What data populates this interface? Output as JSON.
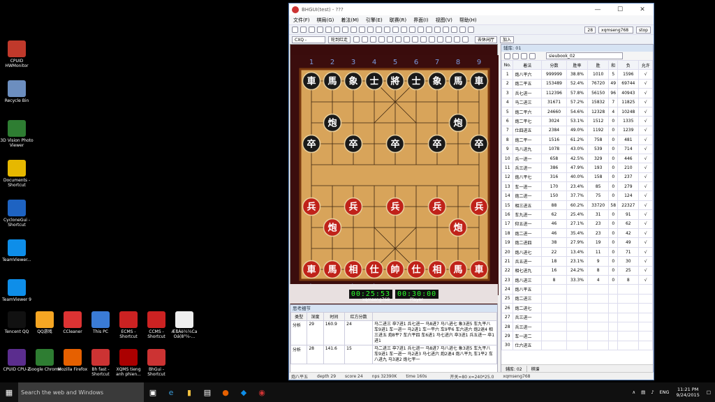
{
  "desktop_icons": [
    {
      "label": "CPUID HWMonitor",
      "icon": "hwmonitor-icon",
      "color": "#c0392b"
    },
    {
      "label": "Recycle Bin",
      "icon": "recycle-bin-icon",
      "color": "#6c8ebf"
    },
    {
      "label": "3D Vision Photo Viewer",
      "icon": "photo-viewer-icon",
      "color": "#2e7d32"
    },
    {
      "label": "Documents - Shortcut",
      "icon": "documents-icon",
      "color": "#e6b800"
    },
    {
      "label": "CycloneGui - Shortcut",
      "icon": "cyclone-icon",
      "color": "#1e63c2"
    },
    {
      "label": "TeamViewer...",
      "icon": "teamviewer-icon",
      "color": "#0e8ee9"
    },
    {
      "label": "TeamViewer 9",
      "icon": "teamviewer9-icon",
      "color": "#0e8ee9"
    }
  ],
  "desktop_row": [
    {
      "label": "Tencent QQ",
      "icon": "qq-icon",
      "color": "#111"
    },
    {
      "label": "QQ游戏",
      "icon": "qq-game-icon",
      "color": "#f5a623"
    },
    {
      "label": "CCleaner",
      "icon": "ccleaner-icon",
      "color": "#d33"
    },
    {
      "label": "This PC",
      "icon": "this-pc-icon",
      "color": "#3a7bd5"
    },
    {
      "label": "ECMS - Shortcut",
      "icon": "ecms-icon",
      "color": "#c22"
    },
    {
      "label": "CCMS - Shortcut",
      "icon": "ccms-icon",
      "color": "#c22"
    },
    {
      "label": "ÆßÁè¼¼Ca Oá(8³¼-...",
      "icon": "file-icon",
      "color": "#eee"
    }
  ],
  "desktop_row2": [
    {
      "label": "CPUID CPU-Z",
      "icon": "cpuz-icon",
      "color": "#5b2d8e"
    },
    {
      "label": "Google Chrome",
      "icon": "chrome-icon",
      "color": "#2e7d32"
    },
    {
      "label": "Mozilla Firefox",
      "icon": "firefox-icon",
      "color": "#e66000"
    },
    {
      "label": "Bh fast - Shortcut",
      "icon": "bh-fast-icon",
      "color": "#c33"
    },
    {
      "label": "XQMS tieng anh phien...",
      "icon": "xqms-icon",
      "color": "#a00"
    },
    {
      "label": "BhGui - Shortcut",
      "icon": "bhgui-icon",
      "color": "#c33"
    }
  ],
  "window": {
    "title": "BHGUI(test) - ???",
    "menu": [
      "文件(F)",
      "棋局(G)",
      "着法(M)",
      "引擎(E)",
      "联赛(R)",
      "界面(I)",
      "视图(V)",
      "帮助(H)"
    ],
    "toolbar_select_level": "28",
    "toolbar_user": "xqmseng768",
    "toolbar_stop": "stop",
    "mode_select": "CXQ - Playing -",
    "side_label": "轮到红走",
    "action1": "去休闲厅",
    "action2": "加入",
    "book_select": "sieubook_02"
  },
  "board": {
    "top_files": [
      "1",
      "2",
      "3",
      "4",
      "5",
      "6",
      "7",
      "8",
      "9"
    ],
    "bottom_files": [
      "九",
      "八",
      "七",
      "六",
      "五",
      "四",
      "三",
      "二",
      "一"
    ],
    "black_back": [
      "車",
      "馬",
      "象",
      "士",
      "將",
      "士",
      "象",
      "馬",
      "車"
    ],
    "black_cannon": "炮",
    "black_pawn": "卒",
    "red_back": [
      "車",
      "馬",
      "相",
      "仕",
      "帥",
      "仕",
      "相",
      "馬",
      "車"
    ],
    "red_cannon": "炮",
    "red_pawn": "兵"
  },
  "clocks": {
    "left": "00:25:53",
    "right": "00:30:00",
    "left_name": "xqmseng768",
    "right_name": "Player"
  },
  "think": {
    "panel_title": "思考细节",
    "headers": [
      "类型",
      "深度",
      "时间",
      "红方分数",
      ""
    ],
    "rows": [
      {
        "type": "分析",
        "depth": "29",
        "time": "160.9",
        "score": "24",
        "pv": "马二进三 卒7进1 兵七进一 马8进7 马八进七 象3进5 车九平八 车9进1 车一进一 马2进1 车一平六 车9平6 车六进六 炮2退4 相三进五 炮8平7 车六平四 车6进1 马七进六 卒3进1 兵五进一 卒1进1"
      },
      {
        "type": "分析",
        "depth": "28",
        "time": "141.6",
        "score": "15",
        "pv": "马二进三 卒7进1 兵七进一 马8进7 马八进七 象3进5 车九平八 车9进1 车一进一 马2进3 马七进六 炮2退4 炮八平九 车1平2 车八进九 马3退2 炮七平一"
      }
    ]
  },
  "book": {
    "panel_title": "辅库: 01",
    "headers": [
      "No.",
      "着法",
      "分数",
      "胜率",
      "胜",
      "和",
      "负",
      "允许"
    ],
    "rows": [
      [
        "1",
        "炮八平六",
        "999999",
        "38.8%",
        "1010",
        "5",
        "1596",
        "√"
      ],
      [
        "2",
        "炮二平五",
        "153489",
        "52.4%",
        "76720",
        "49",
        "69744",
        "√"
      ],
      [
        "3",
        "兵七进一",
        "112396",
        "57.8%",
        "56150",
        "96",
        "40943",
        "√"
      ],
      [
        "4",
        "马二进三",
        "31671",
        "57.2%",
        "15832",
        "7",
        "11825",
        "√"
      ],
      [
        "5",
        "炮二平六",
        "24660",
        "54.6%",
        "12328",
        "4",
        "10248",
        "√"
      ],
      [
        "6",
        "炮二平七",
        "3024",
        "53.1%",
        "1512",
        "0",
        "1335",
        "√"
      ],
      [
        "7",
        "仕四进五",
        "2384",
        "49.0%",
        "1192",
        "0",
        "1239",
        "√"
      ],
      [
        "8",
        "炮二平一",
        "1516",
        "61.2%",
        "758",
        "0",
        "481",
        "√"
      ],
      [
        "9",
        "马八进九",
        "1078",
        "43.0%",
        "539",
        "0",
        "714",
        "√"
      ],
      [
        "10",
        "兵一进一",
        "658",
        "42.5%",
        "329",
        "0",
        "446",
        "√"
      ],
      [
        "11",
        "兵三进一",
        "386",
        "47.9%",
        "193",
        "0",
        "210",
        "√"
      ],
      [
        "12",
        "炮八平七",
        "316",
        "40.0%",
        "158",
        "0",
        "237",
        "√"
      ],
      [
        "13",
        "车一进一",
        "170",
        "23.4%",
        "85",
        "0",
        "279",
        "√"
      ],
      [
        "14",
        "炮二进一",
        "150",
        "37.7%",
        "75",
        "0",
        "124",
        "√"
      ],
      [
        "15",
        "相三进五",
        "88",
        "60.2%",
        "33720",
        "58",
        "22327",
        "√"
      ],
      [
        "16",
        "车九进一",
        "62",
        "25.4%",
        "31",
        "0",
        "91",
        "√"
      ],
      [
        "17",
        "仰五进一",
        "46",
        "27.1%",
        "23",
        "0",
        "62",
        "√"
      ],
      [
        "18",
        "炮二进一",
        "46",
        "35.4%",
        "23",
        "0",
        "42",
        "√"
      ],
      [
        "19",
        "炮二进四",
        "38",
        "27.9%",
        "19",
        "0",
        "49",
        "√"
      ],
      [
        "20",
        "炮八进七",
        "22",
        "13.4%",
        "11",
        "0",
        "71",
        "√"
      ],
      [
        "21",
        "兵五进一",
        "18",
        "23.1%",
        "9",
        "0",
        "30",
        "√"
      ],
      [
        "22",
        "相七进九",
        "16",
        "24.2%",
        "8",
        "0",
        "25",
        "√"
      ],
      [
        "23",
        "炮八进三",
        "8",
        "33.3%",
        "4",
        "0",
        "8",
        "√"
      ],
      [
        "24",
        "炮八平五",
        "",
        "",
        "",
        "",
        "",
        ""
      ],
      [
        "25",
        "炮二进三",
        "",
        "",
        "",
        "",
        "",
        ""
      ],
      [
        "26",
        "炮二进七",
        "",
        "",
        "",
        "",
        "",
        ""
      ],
      [
        "27",
        "兵三进一",
        "",
        "",
        "",
        "",
        "",
        ""
      ],
      [
        "28",
        "兵三进一",
        "",
        "",
        "",
        "",
        "",
        ""
      ],
      [
        "29",
        "车一进二",
        "",
        "",
        "",
        "",
        "",
        ""
      ],
      [
        "30",
        "仕六进五",
        "",
        "",
        "",
        "",
        "",
        ""
      ]
    ],
    "tab1": "辅库: 02",
    "tab2": "棋谱"
  },
  "status": {
    "move": "炮八平五",
    "depth": "depth 29",
    "score": "score 24",
    "nps": "nps 32390K",
    "time": "time 160s",
    "mode": "开关=80 x=240*25.0",
    "user": "xqmseng768"
  },
  "taskbar": {
    "search_placeholder": "Search the web and Windows",
    "lang": "ENG",
    "time": "11:21 PM",
    "date": "9/24/2015"
  }
}
